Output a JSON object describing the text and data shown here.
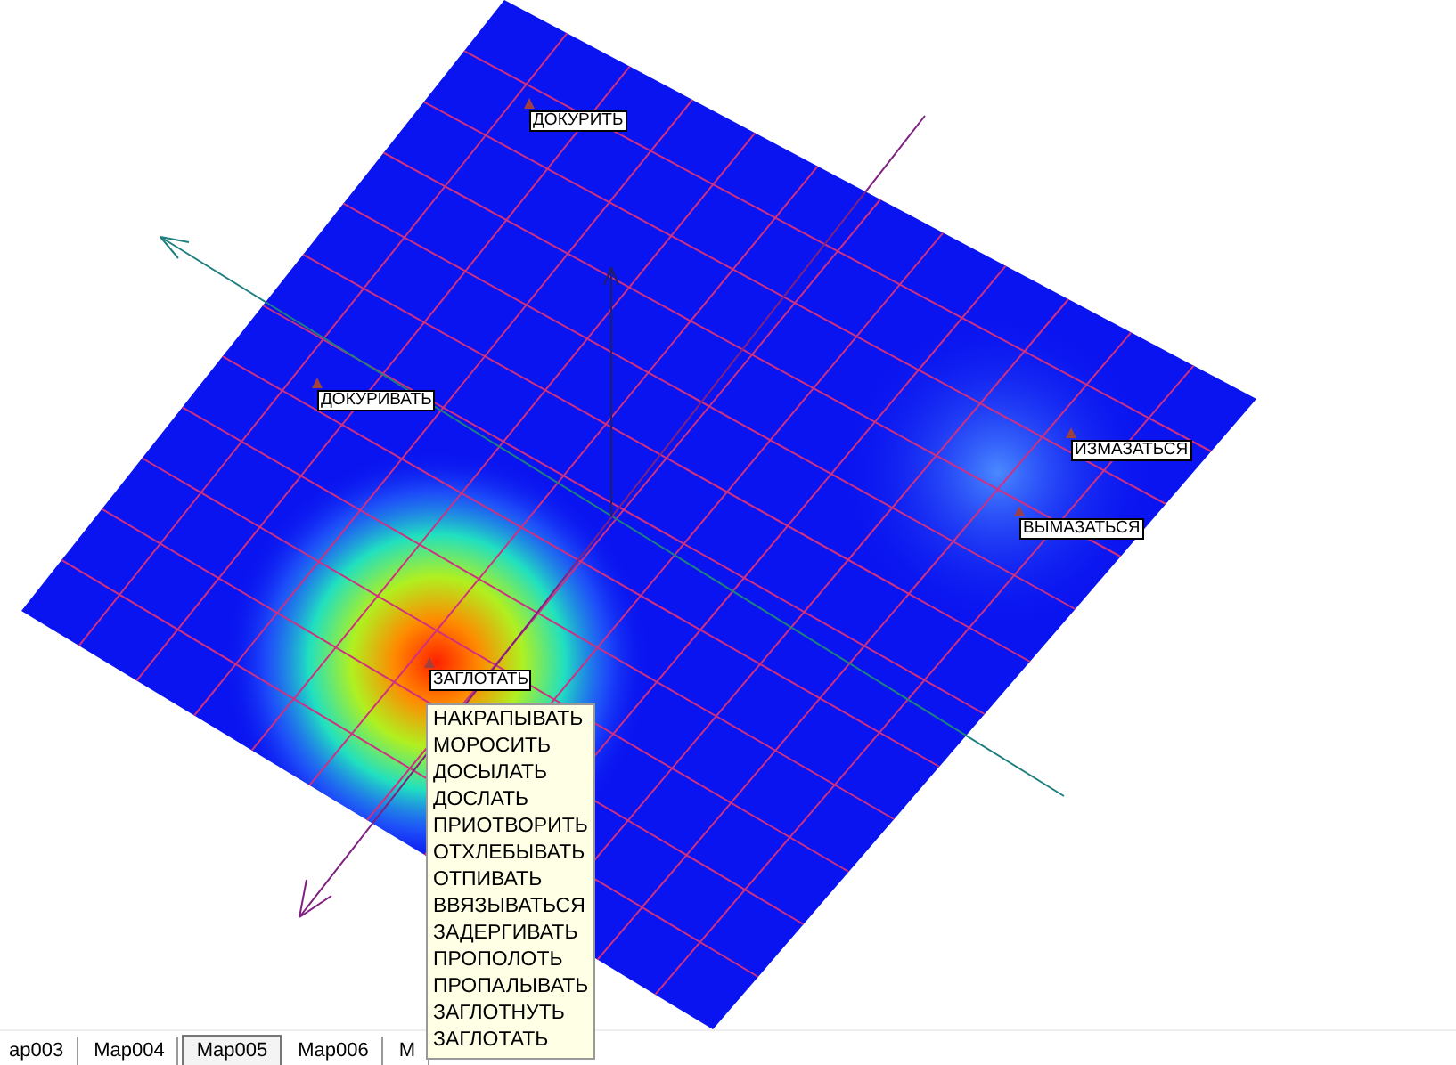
{
  "map_labels": [
    {
      "text": "ДОКУРИТЬ"
    },
    {
      "text": "ДОКУРИВАТЬ"
    },
    {
      "text": "ИЗМАЗАТЬСЯ"
    },
    {
      "text": "ВЫМАЗАТЬСЯ"
    },
    {
      "text": "ЗАГЛОТАТЬ"
    }
  ],
  "tooltip": {
    "items": [
      "НАКРАПЫВАТЬ",
      "МОРОСИТЬ",
      "ДОСЫЛАТЬ",
      "ДОСЛАТЬ",
      "ПРИОТВОРИТЬ",
      "ОТХЛЕБЫВАТЬ",
      "ОТПИВАТЬ",
      "ВВЯЗЫВАТЬСЯ",
      "ЗАДЕРГИВАТЬ",
      "ПРОПОЛОТЬ",
      "ПРОПАЛЫВАТЬ",
      "ЗАГЛОТНУТЬ",
      "ЗАГЛОТАТЬ"
    ]
  },
  "tabs": [
    {
      "label": "ap003",
      "selected": false
    },
    {
      "label": "Map004",
      "selected": false
    },
    {
      "label": "Map005",
      "selected": true
    },
    {
      "label": "Map006",
      "selected": false
    },
    {
      "label": "M",
      "selected": false
    }
  ]
}
